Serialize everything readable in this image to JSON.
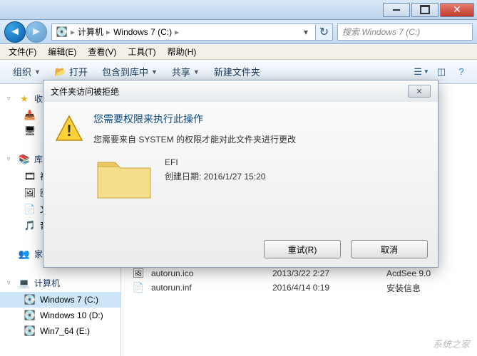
{
  "breadcrumb": {
    "root": "计算机",
    "path1": "Windows 7 (C:)"
  },
  "search": {
    "placeholder": "搜索 Windows 7 (C:)"
  },
  "menu": {
    "file": "文件(F)",
    "edit": "编辑(E)",
    "view": "查看(V)",
    "tools": "工具(T)",
    "help": "帮助(H)"
  },
  "toolbar": {
    "organize": "组织",
    "open": "打开",
    "include": "包含到库中",
    "share": "共享",
    "newfolder": "新建文件夹"
  },
  "sidebar": {
    "fav_header": "收",
    "lib_header": "库",
    "home_header": "家庭组",
    "computer_header": "计算机",
    "drives": {
      "c": "Windows 7 (C:)",
      "d": "Windows 10 (D:)",
      "e": "Win7_64 (E:)"
    },
    "libs": {
      "v": "视",
      "t": "图",
      "w": "文",
      "m": "音"
    }
  },
  "files": {
    "row1": {
      "name": "autorun.ico",
      "date": "2013/3/22 2:27",
      "type": "AcdSee 9.0"
    },
    "row2": {
      "name": "autorun.inf",
      "date": "2016/4/14 0:19",
      "type": "安装信息"
    }
  },
  "dialog": {
    "title": "文件夹访问被拒绝",
    "main_msg": "您需要权限来执行此操作",
    "sub_msg": "您需要来自 SYSTEM 的权限才能对此文件夹进行更改",
    "folder_name": "EFI",
    "created_label": "创建日期: ",
    "created_date": "2016/1/27 15:20",
    "retry": "重试(R)",
    "cancel": "取消"
  },
  "watermark": "系统之家"
}
